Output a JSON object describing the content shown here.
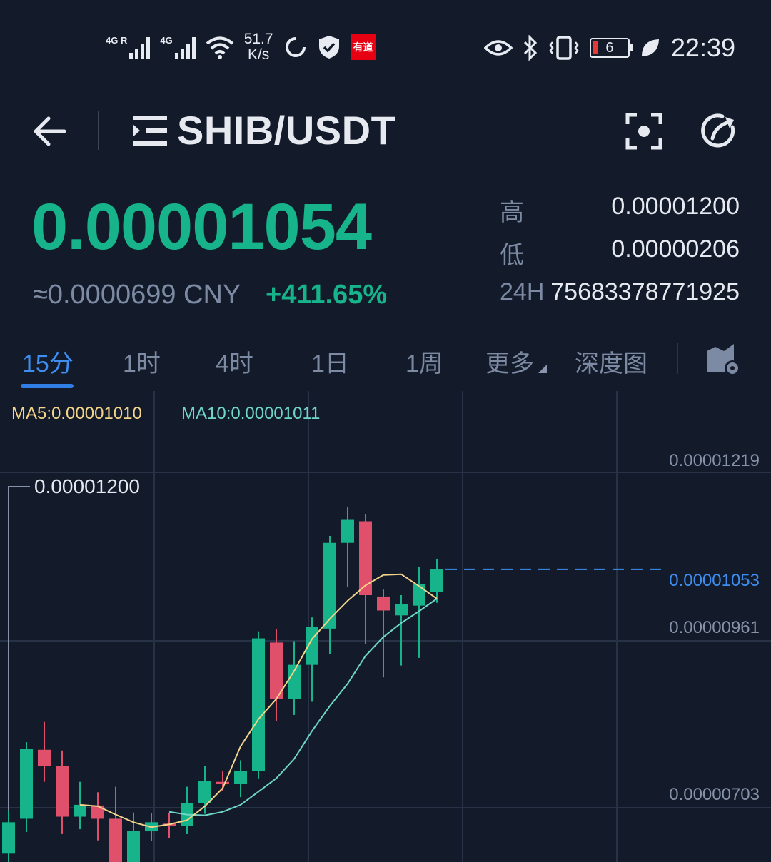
{
  "status_bar": {
    "sim1_label": "4G R",
    "sim2_label": "4G",
    "net_speed_value": "51.7",
    "net_speed_unit": "K/s",
    "app_badge": "有道",
    "battery_level": "6",
    "time": "22:39",
    "battery_color": "#e53935"
  },
  "header": {
    "pair": "SHIB/USDT"
  },
  "ticker": {
    "last_price": "0.00001054",
    "cny_value": "≈0.0000699 CNY",
    "change_pct": "+411.65%",
    "high_label": "高",
    "high_value": "0.00001200",
    "low_label": "低",
    "low_value": "0.00000206",
    "vol_label": "24H",
    "vol_value": "75683378771925"
  },
  "tabs": {
    "items": [
      "15分",
      "1时",
      "4时",
      "1日",
      "1周",
      "更多",
      "深度图"
    ],
    "active": "15分"
  },
  "colors": {
    "up": "#17b38a",
    "down": "#e0506a",
    "ma5": "#f3d48a",
    "ma10": "#6fd6c8",
    "accent": "#3d8ef0"
  },
  "chart_data": {
    "type": "candlestick",
    "indicators": {
      "ma5_label": "MA5:0.00001010",
      "ma10_label": "MA10:0.00001011"
    },
    "y_ticks": [
      "0.00001219",
      "0.00000961",
      "0.00000703"
    ],
    "current_price_label": "0.00001053",
    "high_marker": "0.00001200",
    "ylim": [
      6.4e-06,
      1.236e-05
    ],
    "candles": [
      {
        "o": 6.52e-06,
        "h": 7.03e-06,
        "l": 6.4e-06,
        "c": 6.97e-06
      },
      {
        "o": 7.02e-06,
        "h": 7.95e-06,
        "l": 6.93e-06,
        "c": 8.02e-06
      },
      {
        "o": 8.01e-06,
        "h": 8.31e-06,
        "l": 7.65e-06,
        "c": 7.78e-06
      },
      {
        "o": 7.78e-06,
        "h": 7.9e-06,
        "l": 6.9e-06,
        "c": 7.05e-06
      },
      {
        "o": 7.05e-06,
        "h": 7.45e-06,
        "l": 6.97e-06,
        "c": 7.22e-06
      },
      {
        "o": 7.21e-06,
        "h": 7.3e-06,
        "l": 6.81e-06,
        "c": 7.02e-06
      },
      {
        "o": 7.02e-06,
        "h": 7.38e-06,
        "l": 6.5e-06,
        "c": 6.3e-06
      },
      {
        "o": 6.3e-06,
        "h": 7.01e-06,
        "l": 6.31e-06,
        "c": 6.85e-06
      },
      {
        "o": 6.84e-06,
        "h": 7e-06,
        "l": 6.8e-06,
        "c": 6.97e-06
      },
      {
        "o": 6.95e-06,
        "h": 7e-06,
        "l": 6.84e-06,
        "c": 6.92e-06
      },
      {
        "o": 6.92e-06,
        "h": 7.38e-06,
        "l": 6.9e-06,
        "c": 7.24e-06
      },
      {
        "o": 7.24e-06,
        "h": 7.68e-06,
        "l": 7.19e-06,
        "c": 7.56e-06
      },
      {
        "o": 7.55e-06,
        "h": 7.6e-06,
        "l": 7.52e-06,
        "c": 7.54e-06
      },
      {
        "o": 7.52e-06,
        "h": 7.76e-06,
        "l": 7.43e-06,
        "c": 7.71e-06
      },
      {
        "o": 7.71e-06,
        "h": 9.47e-06,
        "l": 7.7e-06,
        "c": 9.61e-06
      },
      {
        "o": 9.55e-06,
        "h": 9.64e-06,
        "l": 8.52e-06,
        "c": 8.74e-06
      },
      {
        "o": 8.74e-06,
        "h": 9.47e-06,
        "l": 8.61e-06,
        "c": 9.23e-06
      },
      {
        "o": 9.23e-06,
        "h": 9.81e-06,
        "l": 8.8e-06,
        "c": 9.77e-06
      },
      {
        "o": 9.75e-06,
        "h": 1.076e-05,
        "l": 9.48e-06,
        "c": 1.098e-05
      },
      {
        "o": 1.098e-05,
        "h": 1.14e-05,
        "l": 1.045e-05,
        "c": 1.131e-05
      },
      {
        "o": 1.129e-05,
        "h": 1.115e-05,
        "l": 9.63e-06,
        "c": 1.023e-05
      },
      {
        "o": 1.021e-05,
        "h": 1.018e-05,
        "l": 9.15e-06,
        "c": 1.001e-05
      },
      {
        "o": 9.94e-06,
        "h": 1.013e-05,
        "l": 9.32e-06,
        "c": 1.01e-05
      },
      {
        "o": 1.008e-05,
        "h": 1.054e-05,
        "l": 9.43e-06,
        "c": 1.039e-05
      },
      {
        "o": 1.028e-05,
        "h": 1.065e-05,
        "l": 1.022e-05,
        "c": 1.06e-05
      }
    ],
    "ma5": [
      null,
      null,
      null,
      null,
      7.22e-06,
      7.2e-06,
      7.08e-06,
      6.97e-06,
      6.9e-06,
      6.94e-06,
      7e-06,
      7.2e-06,
      7.46e-06,
      8.06e-06,
      8.45e-06,
      8.74e-06,
      9.14e-06,
      9.6e-06,
      9.89e-06,
      1.015e-05,
      1.037e-05,
      1.052e-05,
      1.053e-05,
      1.036e-05,
      1.018e-05
    ],
    "ma10": [
      null,
      null,
      null,
      null,
      null,
      null,
      null,
      null,
      null,
      7.12e-06,
      7.08e-06,
      7.07e-06,
      7.12e-06,
      7.22e-06,
      7.41e-06,
      7.6e-06,
      7.88e-06,
      8.28e-06,
      8.64e-06,
      8.96e-06,
      9.36e-06,
      9.63e-06,
      9.83e-06,
      1e-05,
      1.018e-05
    ]
  }
}
